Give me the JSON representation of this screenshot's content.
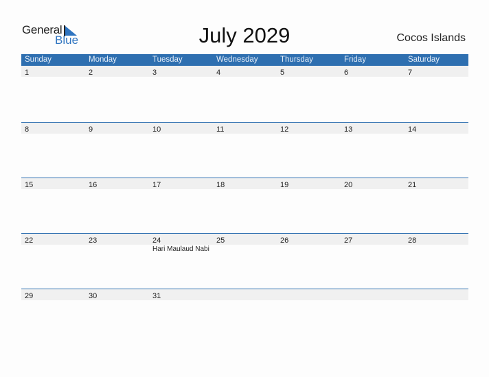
{
  "logo": {
    "line1": "General",
    "line2": "Blue"
  },
  "title": "July 2029",
  "country": "Cocos Islands",
  "colors": {
    "accent": "#2e6fb0",
    "strip": "#f0f0f0"
  },
  "weekdays": [
    "Sunday",
    "Monday",
    "Tuesday",
    "Wednesday",
    "Thursday",
    "Friday",
    "Saturday"
  ],
  "weeks": [
    [
      {
        "d": "1"
      },
      {
        "d": "2"
      },
      {
        "d": "3"
      },
      {
        "d": "4"
      },
      {
        "d": "5"
      },
      {
        "d": "6"
      },
      {
        "d": "7"
      }
    ],
    [
      {
        "d": "8"
      },
      {
        "d": "9"
      },
      {
        "d": "10"
      },
      {
        "d": "11"
      },
      {
        "d": "12"
      },
      {
        "d": "13"
      },
      {
        "d": "14"
      }
    ],
    [
      {
        "d": "15"
      },
      {
        "d": "16"
      },
      {
        "d": "17"
      },
      {
        "d": "18"
      },
      {
        "d": "19"
      },
      {
        "d": "20"
      },
      {
        "d": "21"
      }
    ],
    [
      {
        "d": "22"
      },
      {
        "d": "23"
      },
      {
        "d": "24",
        "event": "Hari Maulaud Nabi"
      },
      {
        "d": "25"
      },
      {
        "d": "26"
      },
      {
        "d": "27"
      },
      {
        "d": "28"
      }
    ],
    [
      {
        "d": "29"
      },
      {
        "d": "30"
      },
      {
        "d": "31"
      },
      {
        "d": ""
      },
      {
        "d": ""
      },
      {
        "d": ""
      },
      {
        "d": ""
      }
    ]
  ]
}
